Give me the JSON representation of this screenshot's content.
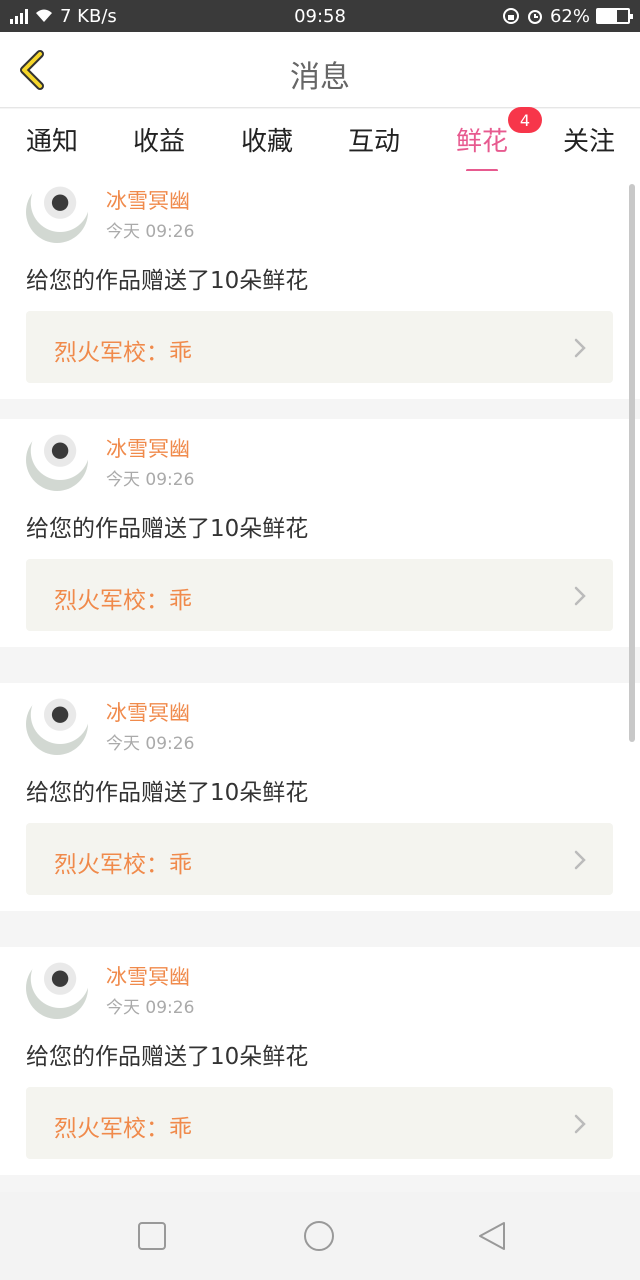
{
  "status_bar": {
    "speed": "7 KB/s",
    "time": "09:58",
    "battery": "62%",
    "battery_level": 0.62
  },
  "header": {
    "title": "消息",
    "back_icon": "chevron-left-icon"
  },
  "tabs": [
    {
      "label": "通知",
      "active": false
    },
    {
      "label": "收益",
      "active": false
    },
    {
      "label": "收藏",
      "active": false
    },
    {
      "label": "互动",
      "active": false
    },
    {
      "label": "鲜花",
      "active": true,
      "badge": "4"
    },
    {
      "label": "关注",
      "active": false
    }
  ],
  "messages": [
    {
      "username": "冰雪冥幽",
      "time": "今天 09:26",
      "text": "给您的作品赠送了10朵鲜花",
      "work": "烈火军校：乖"
    },
    {
      "username": "冰雪冥幽",
      "time": "今天 09:26",
      "text": "给您的作品赠送了10朵鲜花",
      "work": "烈火军校：乖"
    },
    {
      "username": "冰雪冥幽",
      "time": "今天 09:26",
      "text": "给您的作品赠送了10朵鲜花",
      "work": "烈火军校：乖"
    },
    {
      "username": "冰雪冥幽",
      "time": "今天 09:26",
      "text": "给您的作品赠送了10朵鲜花",
      "work": "烈火军校：乖"
    }
  ],
  "colors": {
    "accent": "#e75a8f",
    "username": "#f08a4b",
    "badge": "#f7364a",
    "back_arrow": "#f5d62b"
  },
  "nav_bar": {
    "icons": [
      "recent-apps-icon",
      "home-icon",
      "back-icon"
    ]
  }
}
